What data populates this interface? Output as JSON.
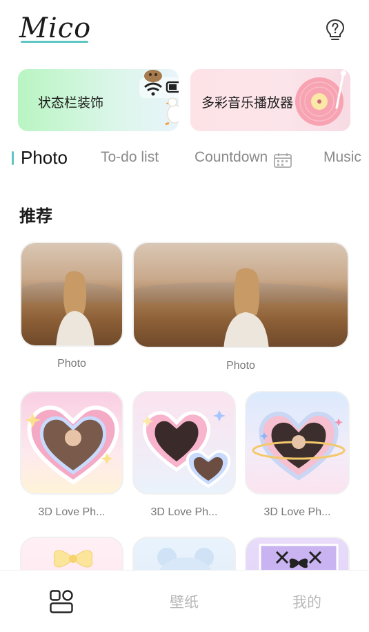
{
  "header": {
    "logo": "Mico",
    "help_icon": "question-bulb-icon",
    "accent_color": "#5ec5c2"
  },
  "banners": [
    {
      "label": "状态栏装饰"
    },
    {
      "label": "多彩音乐播放器"
    }
  ],
  "tabs": [
    {
      "label": "Photo",
      "active": true
    },
    {
      "label": "To-do list",
      "active": false
    },
    {
      "label": "Countdown",
      "active": false
    },
    {
      "label": "Music",
      "active": false
    }
  ],
  "section": {
    "title": "推荐"
  },
  "widgets": [
    {
      "label": "Photo"
    },
    {
      "label": "Photo"
    },
    {
      "label": "3D Love Ph..."
    },
    {
      "label": "3D Love Ph..."
    },
    {
      "label": "3D Love Ph..."
    }
  ],
  "bottom_nav": {
    "items": [
      {
        "label": "",
        "icon": "widgets-grid-icon",
        "active": true
      },
      {
        "label": "壁纸",
        "active": false
      },
      {
        "label": "我的",
        "active": false
      }
    ]
  }
}
